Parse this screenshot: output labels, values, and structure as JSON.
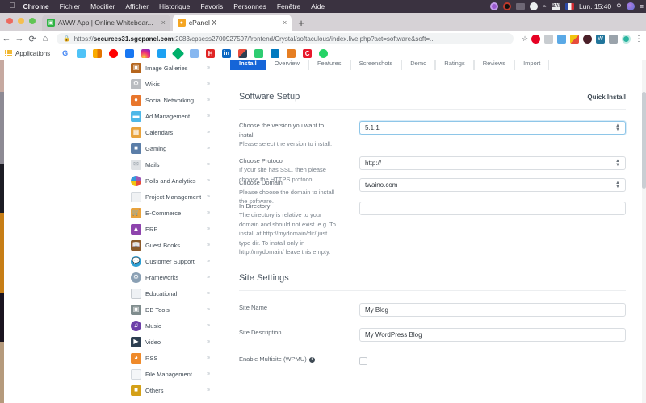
{
  "os_menu": {
    "apple_icon": "apple-logo",
    "items": [
      "Chrome",
      "Fichier",
      "Modifier",
      "Afficher",
      "Historique",
      "Favoris",
      "Personnes",
      "Fenêtre",
      "Aide"
    ],
    "tray": {
      "clock": "Lun. 15:40",
      "icons": [
        "record-icon",
        "screen-share-icon",
        "battery-icon",
        "cloud-icon",
        "wifi-icon",
        "input-source-badge",
        "flag-icon",
        "search-icon",
        "siri-icon",
        "control-center-icon"
      ],
      "battery_badge": "BAT"
    }
  },
  "browser": {
    "tabs": [
      {
        "title": "AWW App | Online Whiteboar...",
        "favicon": "whiteboard-icon",
        "active": false,
        "close": "×"
      },
      {
        "title": "cPanel X",
        "favicon": "cpanel-icon",
        "active": true,
        "close": "×"
      }
    ],
    "new_tab_label": "+",
    "nav": {
      "back": "←",
      "forward": "→",
      "reload": "C",
      "home": "⌂"
    },
    "omnibox": {
      "scheme": "https://",
      "host": "securees31.sgcpanel.com",
      "path": ":2083/cpsess2700927597/frontend/Crystal/softaculous/index.live.php?act=software&soft=...",
      "lock_icon": "lock-icon",
      "star_icon": "star-icon"
    },
    "bookmarks": {
      "apps_label": "Applications",
      "items": [
        "google-icon",
        "mail-icon",
        "analytics-icon",
        "youtube-icon",
        "facebook-icon",
        "instagram-icon",
        "twitter-icon",
        "diamond-icon",
        "tools-icon",
        "h-icon",
        "linkedin-icon",
        "grid-icon",
        "plugin-icon",
        "trello-icon",
        "chart-icon",
        "crm-icon",
        "whatsapp-icon"
      ]
    },
    "toolbar_extensions": [
      "pinterest-icon",
      "keyboard-icon",
      "download-icon",
      "colorful-icon",
      "dark-circle-icon",
      "wp-icon",
      "cursor-icon",
      "profile-icon",
      "menu-icon"
    ]
  },
  "sidebar": {
    "items": [
      {
        "label": "Image Galleries",
        "icon": "gallery-icon",
        "color": "#b5651d"
      },
      {
        "label": "Wikis",
        "icon": "wiki-icon",
        "color": "#b9bcc0"
      },
      {
        "label": "Social Networking",
        "icon": "social-icon",
        "color": "#e8762c"
      },
      {
        "label": "Ad Management",
        "icon": "ads-icon",
        "color": "#4eb8e8"
      },
      {
        "label": "Calendars",
        "icon": "calendar-icon",
        "color": "#e8a33d"
      },
      {
        "label": "Gaming",
        "icon": "gaming-icon",
        "color": "#5b7ea8"
      },
      {
        "label": "Mails",
        "icon": "mail-icon",
        "color": "#dfe2e5"
      },
      {
        "label": "Polls and Analytics",
        "icon": "polls-icon",
        "color": "#9b59b6"
      },
      {
        "label": "Project Management",
        "icon": "project-icon",
        "color": "#dfe2e5"
      },
      {
        "label": "E-Commerce",
        "icon": "cart-icon",
        "color": "#e8a33d"
      },
      {
        "label": "ERP",
        "icon": "erp-icon",
        "color": "#8e44ad"
      },
      {
        "label": "Guest Books",
        "icon": "book-icon",
        "color": "#8b5a2b"
      },
      {
        "label": "Customer Support",
        "icon": "support-icon",
        "color": "#2e9fd4"
      },
      {
        "label": "Frameworks",
        "icon": "frameworks-icon",
        "color": "#8aa0b4"
      },
      {
        "label": "Educational",
        "icon": "education-icon",
        "color": "#c7ccd1"
      },
      {
        "label": "DB Tools",
        "icon": "database-icon",
        "color": "#7f8c8d"
      },
      {
        "label": "Music",
        "icon": "music-icon",
        "color": "#6c3fa8"
      },
      {
        "label": "Video",
        "icon": "video-icon",
        "color": "#2c3e50"
      },
      {
        "label": "RSS",
        "icon": "rss-icon",
        "color": "#ef8a2a"
      },
      {
        "label": "File Management",
        "icon": "file-icon",
        "color": "#dfe2e5"
      },
      {
        "label": "Others",
        "icon": "others-icon",
        "color": "#d4a017"
      }
    ],
    "caret": "›"
  },
  "product_tabs": [
    {
      "label": "Install",
      "selected": true
    },
    {
      "label": "Overview",
      "selected": false
    },
    {
      "label": "Features",
      "selected": false
    },
    {
      "label": "Screenshots",
      "selected": false
    },
    {
      "label": "Demo",
      "selected": false
    },
    {
      "label": "Ratings",
      "selected": false
    },
    {
      "label": "Reviews",
      "selected": false
    },
    {
      "label": "Import",
      "selected": false
    }
  ],
  "software_setup": {
    "title": "Software Setup",
    "quick_install": "Quick Install",
    "fields": [
      {
        "label": "Choose the version you want to install",
        "desc": "Please select the version to install.",
        "value": "5.1.1",
        "type": "select",
        "focused": true,
        "name": "version-select"
      },
      {
        "label": "Choose Protocol",
        "desc": "If your site has SSL, then please choose the HTTPS protocol.",
        "value": "http://",
        "type": "select",
        "focused": false,
        "name": "protocol-select"
      },
      {
        "label": "Choose Domain",
        "desc": "Please choose the domain to install the software.",
        "value": "twaino.com",
        "type": "select",
        "focused": false,
        "name": "domain-select"
      },
      {
        "label": "In Directory",
        "desc": "The directory is relative to your domain and should not exist. e.g. To install at http://mydomain/dir/ just type dir. To install only in http://mydomain/ leave this empty.",
        "value": "",
        "type": "text",
        "focused": false,
        "name": "directory-input"
      }
    ]
  },
  "site_settings": {
    "title": "Site Settings",
    "rows": [
      {
        "label": "Site Name",
        "value": "My Blog",
        "type": "text",
        "name": "site-name-input"
      },
      {
        "label": "Site Description",
        "value": "My WordPress Blog",
        "type": "text",
        "name": "site-description-input"
      },
      {
        "label": "Enable Multisite (WPMU)",
        "value": "",
        "type": "checkbox",
        "checked": false,
        "name": "enable-multisite-checkbox",
        "info": "i"
      }
    ]
  },
  "colors": {
    "accent": "#1565d8",
    "menubar_bg": "#3a3240",
    "tabstrip_bg": "#d6d2d6",
    "focus_ring": "#8ec6e8"
  }
}
